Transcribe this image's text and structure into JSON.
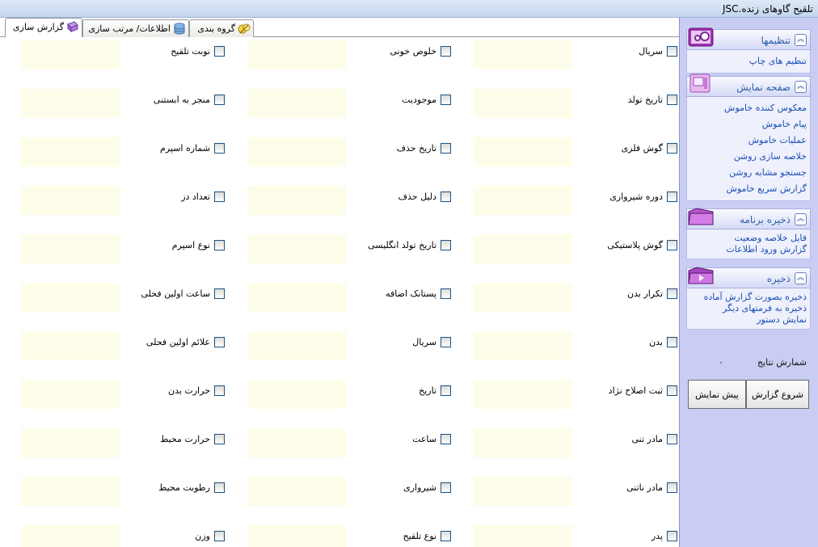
{
  "window": {
    "title": "تلقیح گاوهای زنده.JSC"
  },
  "tabs": [
    {
      "label": "گزارش سازی"
    },
    {
      "label": "اطلاعات/ مرتب سازی"
    },
    {
      "label": "گروه بندی"
    }
  ],
  "fields": {
    "col1": [
      "سریال",
      "تاریخ تولد",
      "گوش فلزی",
      "دوره شیرواری",
      "گوش پلاستیکی",
      "تکرار بدن",
      "بدن",
      "ثبت اصلاح نژاد",
      "مادر تنی",
      "مادر ناتنی",
      "پدر"
    ],
    "col2": [
      "خلوص خونی",
      "موجودیت",
      "تاریخ حذف",
      "دلیل حذف",
      "تاریخ تولد انگلیسی",
      "پستانک اضافه",
      "سریال",
      "تاریخ",
      "ساعت",
      "شیرواری",
      "نوع تلقیح"
    ],
    "col3": [
      "نوبت تلقیح",
      "منجر به ابستنی",
      "شماره اسپرم",
      "تعداد دز",
      "نوع اسپرم",
      "ساعت اولین فحلی",
      "علائم اولین فحلی",
      "حرارت بدن",
      "حرارت محیط",
      "رطوبت محیط",
      "وزن"
    ]
  },
  "sidebar": {
    "settings": {
      "title": "تنظیمها",
      "items": [
        "تنظیم های چاپ"
      ]
    },
    "display": {
      "title": "صفحه نمایش",
      "items": [
        "معکوس کننده خاموش",
        "پیام خاموش",
        "عملیات خاموش",
        "خلاصه سازی روشن",
        "جستجو مشابه روشن",
        "گزارش سریع خاموش"
      ]
    },
    "program_save": {
      "title": "ذخیره برنامه",
      "items": [
        "فایل خلاصه وضعیت",
        "گزارش ورود اطلاعات"
      ]
    },
    "save": {
      "title": "ذخیره",
      "items": [
        "ذخیره بصورت گزارش آماده",
        "ذخیره به فرمتهای دیگر",
        "نمایش دستور"
      ]
    },
    "result_count_label": "شمارش نتایج",
    "result_count_value": "۰",
    "start_button": "شروع گزارش",
    "preview_button": "پیش نمایش"
  },
  "icons": {
    "collapse": "chevron-up-icon",
    "tab_report": "report-icon",
    "tab_sort": "database-icon",
    "tab_group": "group-icon"
  },
  "colors": {
    "panel_bg": "#c9cdf3",
    "link": "#1b4fb5",
    "section_title": "#2f5fa8",
    "field_box": "#fdfde9"
  }
}
